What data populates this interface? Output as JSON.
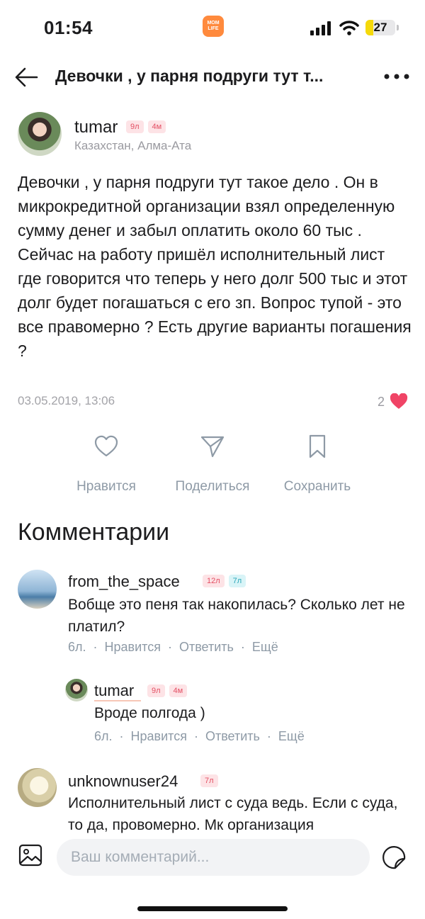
{
  "status_bar": {
    "time": "01:54",
    "app_logo_text": "MOM LIFE",
    "battery": "27",
    "battery_level": 0.27,
    "icons": [
      "signal-icon",
      "wifi-icon",
      "battery-icon"
    ]
  },
  "header": {
    "title": "Девочки , у парня подруги тут т...",
    "icons": [
      "back-arrow-icon",
      "more-icon"
    ]
  },
  "post": {
    "author": {
      "name": "tumar",
      "badges": [
        "9л",
        "4м"
      ],
      "location": "Казахстан, Алма-Ата"
    },
    "text": "Девочки , у парня подруги тут такое дело . Он в микрокредитной организации взял определенную сумму денег и забыл оплатить около 60 тыс . Сейчас на работу пришёл исполнительный лист где говорится что теперь у него долг 500 тыс и этот долг будет погашаться с его зп. Вопрос тупой - это все правомерно ? Есть другие варианты погашения ?",
    "date": "03.05.2019, 13:06",
    "likes": "2",
    "accent_color": "#f04466"
  },
  "actions": {
    "like": "Нравится",
    "share": "Поделиться",
    "save": "Сохранить"
  },
  "comments_title": "Комментарии",
  "comments": [
    {
      "name": "from_the_space",
      "badges": [
        "12л",
        "7л"
      ],
      "text": "Вобще это пеня так накопилась?  Сколько лет не платил?",
      "age": "6л.",
      "like": "Нравится",
      "reply": "Ответить",
      "more": "Ещё"
    },
    {
      "name": "tumar",
      "badges": [
        "9л",
        "4м"
      ],
      "text": "Вроде  полгода )",
      "age": "6л.",
      "like": "Нравится",
      "reply": "Ответить",
      "more": "Ещё"
    },
    {
      "name": "unknownuser24",
      "badges": [
        "7л"
      ],
      "text": "Исполнительный лист с суда  ведь. Если с суда, то да, провомерно. Мк организация"
    }
  ],
  "input": {
    "placeholder": "Ваш комментарий..."
  }
}
